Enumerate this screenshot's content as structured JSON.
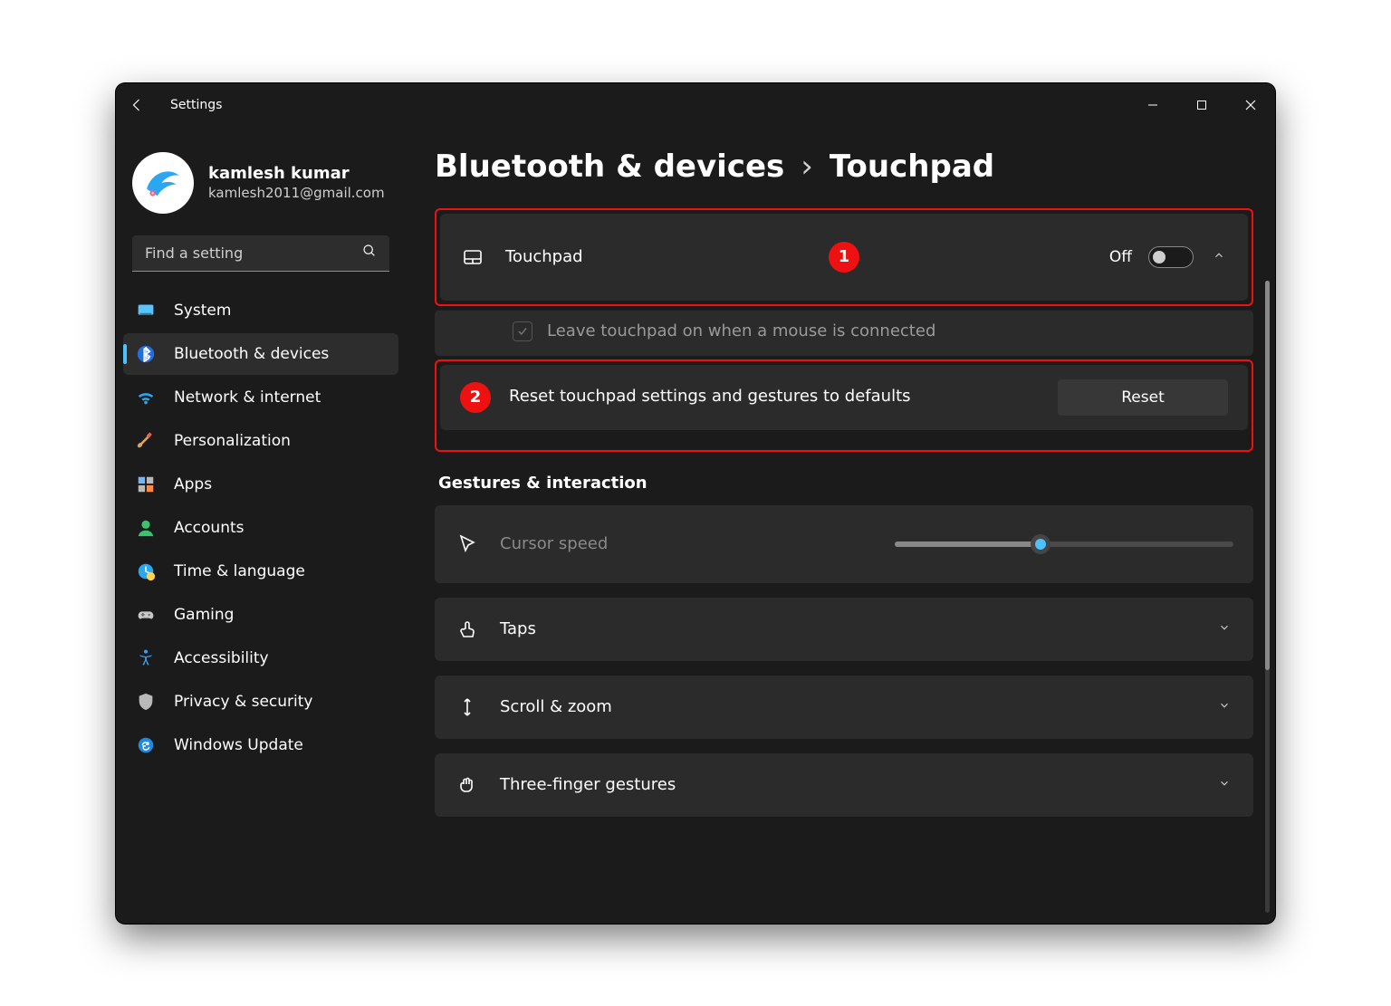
{
  "window": {
    "app_title": "Settings"
  },
  "profile": {
    "name": "kamlesh kumar",
    "email": "kamlesh2011@gmail.com"
  },
  "search": {
    "placeholder": "Find a setting"
  },
  "sidebar": {
    "items": [
      {
        "label": "System"
      },
      {
        "label": "Bluetooth & devices"
      },
      {
        "label": "Network & internet"
      },
      {
        "label": "Personalization"
      },
      {
        "label": "Apps"
      },
      {
        "label": "Accounts"
      },
      {
        "label": "Time & language"
      },
      {
        "label": "Gaming"
      },
      {
        "label": "Accessibility"
      },
      {
        "label": "Privacy & security"
      },
      {
        "label": "Windows Update"
      }
    ],
    "active_index": 1
  },
  "breadcrumb": {
    "parent": "Bluetooth & devices",
    "separator": "›",
    "current": "Touchpad"
  },
  "touchpad_panel": {
    "title": "Touchpad",
    "toggle_state": "Off",
    "sub_checkbox_label": "Leave touchpad on when a mouse is connected",
    "reset_label": "Reset touchpad settings and gestures to defaults",
    "reset_button": "Reset"
  },
  "gestures_section": {
    "title": "Gestures & interaction",
    "rows": [
      {
        "label": "Cursor speed"
      },
      {
        "label": "Taps"
      },
      {
        "label": "Scroll & zoom"
      },
      {
        "label": "Three-finger gestures"
      }
    ]
  },
  "annotations": {
    "badge1": "1",
    "badge2": "2"
  }
}
